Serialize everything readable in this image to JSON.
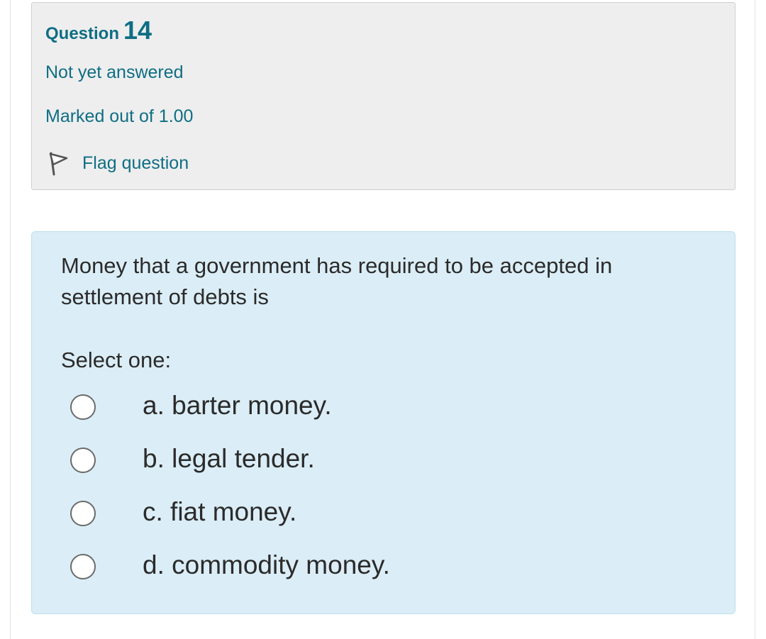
{
  "info": {
    "question_label": "Question",
    "question_number": "14",
    "state": "Not yet answered",
    "grade": "Marked out of 1.00",
    "flag_label": "Flag question"
  },
  "question": {
    "text": "Money that a government has required to be accepted in settlement of debts is",
    "prompt": "Select one:",
    "answers": [
      {
        "label": "a. barter money.",
        "selected": false
      },
      {
        "label": "b. legal tender.",
        "selected": false
      },
      {
        "label": "c. fiat money.",
        "selected": false
      },
      {
        "label": "d. commodity money.",
        "selected": false
      }
    ]
  },
  "colors": {
    "accent": "#0f6e84",
    "info_background": "#eeeeee",
    "content_background": "#dbedf6",
    "text": "#2b2b2b"
  }
}
